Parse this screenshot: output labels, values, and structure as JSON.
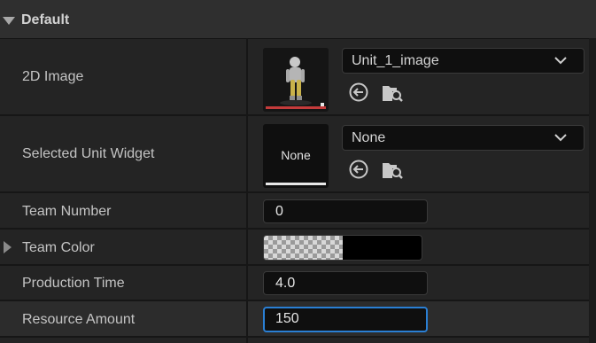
{
  "category": {
    "title": "Default"
  },
  "properties": {
    "image_2d": {
      "label": "2D Image",
      "asset_value": "Unit_1_image",
      "bar_color": "#c43b3b"
    },
    "selected_unit_widget": {
      "label": "Selected Unit Widget",
      "thumbnail_text": "None",
      "asset_value": "None",
      "bar_color": "#e8e8e8"
    },
    "team_number": {
      "label": "Team Number",
      "value": "0"
    },
    "team_color": {
      "label": "Team Color",
      "color": "#000000"
    },
    "production_time": {
      "label": "Production Time",
      "value": "4.0"
    },
    "resource_amount": {
      "label": "Resource Amount",
      "value": "150"
    }
  },
  "icons": {
    "use_selected": "use-selected-asset-icon",
    "browse": "browse-to-asset-icon",
    "dropdown": "chevron-down-icon",
    "collapse": "collapse-arrow-icon",
    "expand": "expand-arrow-icon"
  },
  "colors": {
    "background": "#242424",
    "header": "#2f2f2f",
    "field": "#0f0f0f",
    "focus_border": "#2a7fd4"
  }
}
